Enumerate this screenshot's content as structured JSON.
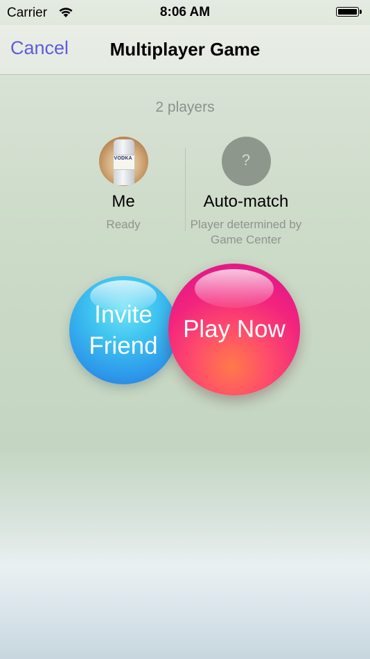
{
  "status_bar": {
    "carrier": "Carrier",
    "time": "8:06 AM"
  },
  "nav": {
    "cancel_label": "Cancel",
    "title": "Multiplayer Game"
  },
  "players": {
    "count_label": "2 players",
    "me": {
      "name": "Me",
      "status": "Ready",
      "avatar_text": "VODKA"
    },
    "auto": {
      "name": "Auto-match",
      "status": "Player determined by Game Center",
      "placeholder": "?"
    }
  },
  "actions": {
    "invite_label": "Invite Friend",
    "play_label": "Play Now"
  },
  "colors": {
    "accent": "#5f5adf",
    "invite_bubble": "#3fc4f0",
    "play_bubble": "#f2247e"
  }
}
